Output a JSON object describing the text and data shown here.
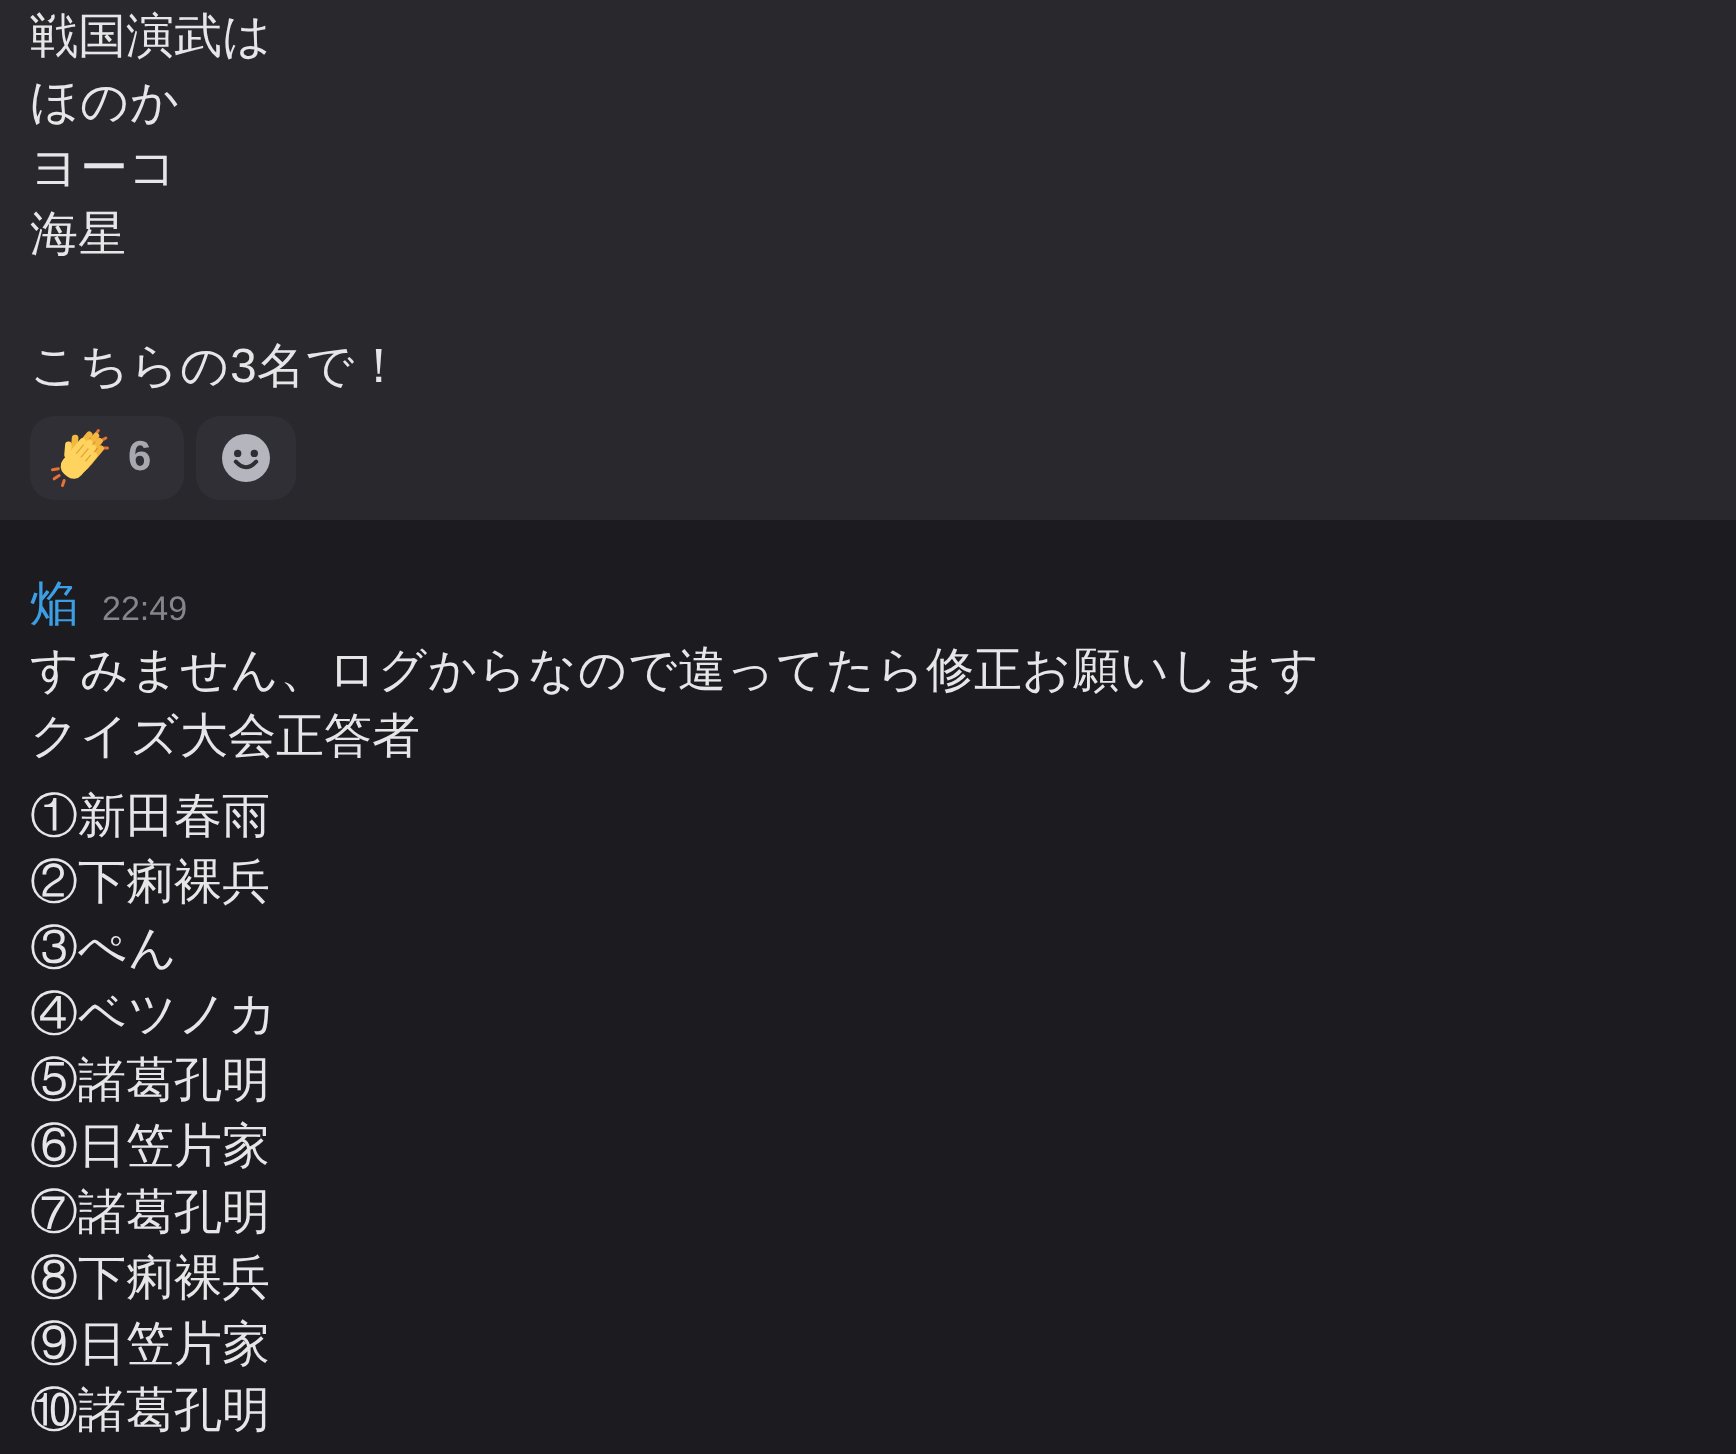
{
  "messages": [
    {
      "highlighted": true,
      "blocks": [
        {
          "kind": "paragraph",
          "lines": [
            "戦国演武は",
            "ほのか",
            "ヨーコ",
            "海星"
          ]
        },
        {
          "kind": "blank_line"
        },
        {
          "kind": "paragraph",
          "lines": [
            "こちらの3名で！"
          ]
        }
      ],
      "reactions": [
        {
          "kind": "emoji",
          "count": "6",
          "selected": false
        },
        {
          "kind": "add"
        }
      ]
    },
    {
      "highlighted": false,
      "author": {
        "name": "焔",
        "color": "#3c9ee3"
      },
      "time": "22:49",
      "blocks": [
        {
          "kind": "paragraph",
          "lines": [
            "すみません、ログからなので違ってたら修正お願いします",
            "クイズ大会正答者"
          ]
        },
        {
          "kind": "list",
          "lines": [
            "①新田春雨",
            "②下痢裸兵",
            "③ぺん",
            "④ベツノカ",
            "⑤諸葛孔明",
            "⑥日笠片家",
            "⑦諸葛孔明",
            "⑧下痢裸兵",
            "⑨日笠片家",
            "⑩諸葛孔明"
          ]
        }
      ]
    }
  ]
}
